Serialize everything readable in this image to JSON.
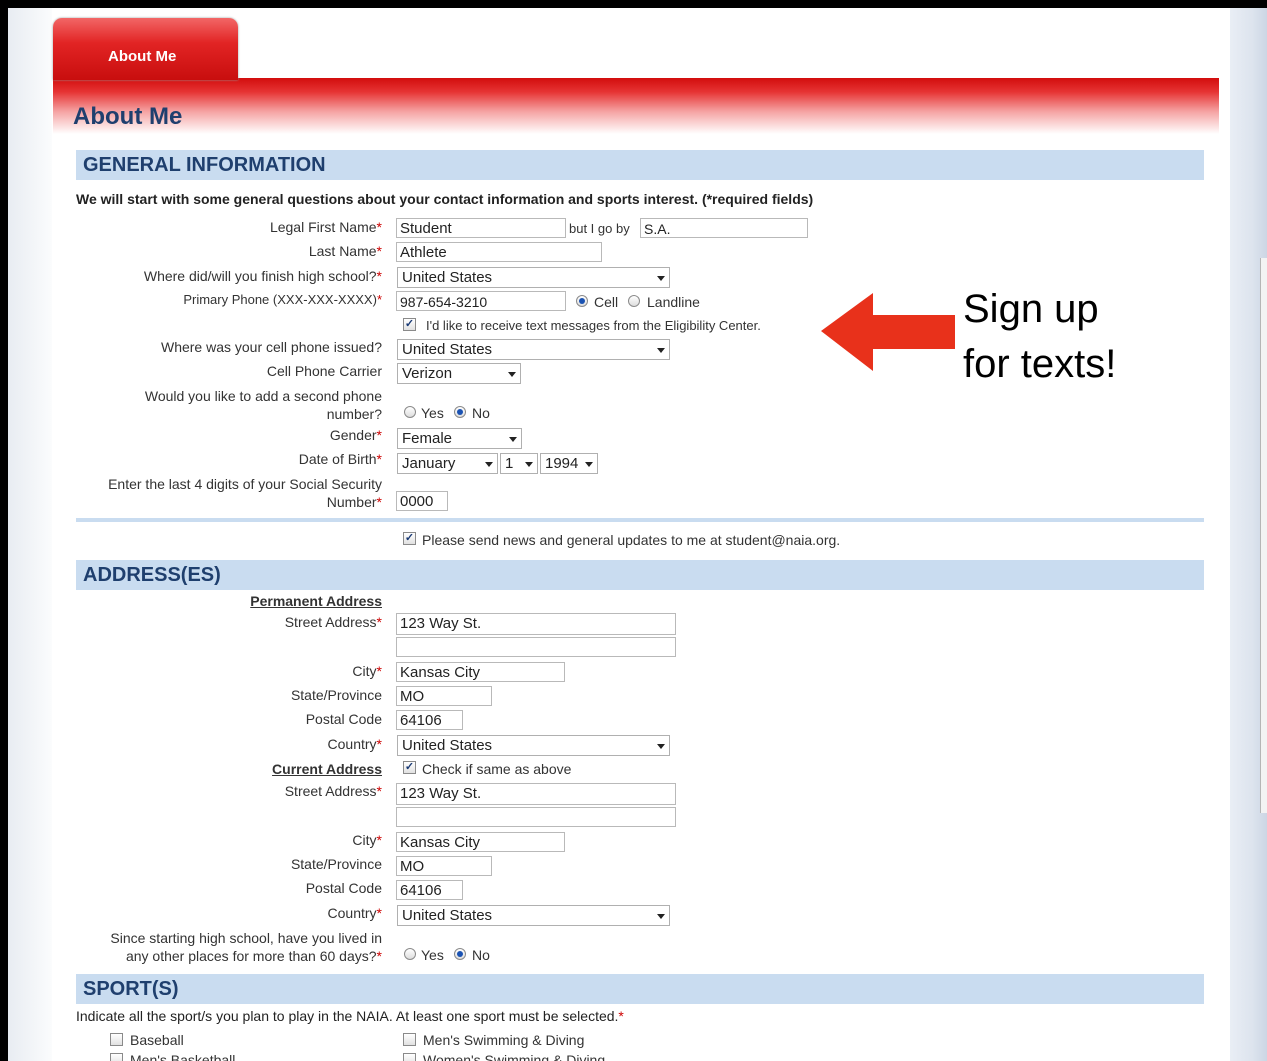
{
  "tab": {
    "label": "About Me"
  },
  "page_title": "About Me",
  "sections": {
    "general": "GENERAL INFORMATION",
    "address": "ADDRESS(ES)",
    "sport": "SPORT(S)"
  },
  "intro": "We will start with some general questions about your contact information and sports interest. (*required fields)",
  "general": {
    "first_name_label": "Legal First Name",
    "first_name_value": "Student",
    "go_by_label": "but I go by",
    "go_by_value": "S.A.",
    "last_name_label": "Last Name",
    "last_name_value": "Athlete",
    "hs_country_label": "Where did/will you finish high school?",
    "hs_country_value": "United States",
    "phone_label": "Primary Phone (XXX-XXX-XXXX)",
    "phone_value": "987-654-3210",
    "cell_label": "Cell",
    "landline_label": "Landline",
    "text_opt_label": "I'd like to receive text messages from the Eligibility Center.",
    "cell_issued_label": "Where was your cell phone issued?",
    "cell_issued_value": "United States",
    "carrier_label": "Cell Phone Carrier",
    "carrier_value": "Verizon",
    "second_phone_label_1": "Would you like to add a second phone",
    "second_phone_label_2": "number?",
    "yes_label": "Yes",
    "no_label": "No",
    "gender_label": "Gender",
    "gender_value": "Female",
    "dob_label": "Date of Birth",
    "dob_month": "January",
    "dob_day": "1",
    "dob_year": "1994",
    "ssn_label_1": "Enter the last 4 digits of your Social Security",
    "ssn_label_2": "Number",
    "ssn_value": "0000",
    "news_label": "Please send news and general updates to me at student@naia.org."
  },
  "address": {
    "permanent_heading": "Permanent Address",
    "street_label": "Street Address",
    "street_value": "123 Way St.",
    "city_label": "City",
    "city_value": "Kansas City",
    "state_label": "State/Province",
    "state_value": "MO",
    "postal_label": "Postal Code",
    "postal_value": "64106",
    "country_label": "Country",
    "country_value": "United States",
    "current_heading": "Current Address",
    "same_label": "Check if same as above",
    "lived_label_1": "Since starting high school, have you lived in",
    "lived_label_2": "any other places for more than 60 days?",
    "yes_label": "Yes",
    "no_label": "No"
  },
  "sport": {
    "intro": "Indicate all the sport/s you plan to play in the NAIA. At least one sport must be selected.",
    "items": [
      "Baseball",
      "Men's Swimming & Diving",
      "Men's Basketball",
      "Women's Swimming & Diving"
    ]
  },
  "callout": {
    "line1": "Sign up",
    "line2": "for texts!"
  },
  "colors": {
    "tab_red": "#e22424",
    "section_blue": "#c9dcf0",
    "title_navy": "#1f3f6e",
    "arrow_red": "#e8311b"
  }
}
